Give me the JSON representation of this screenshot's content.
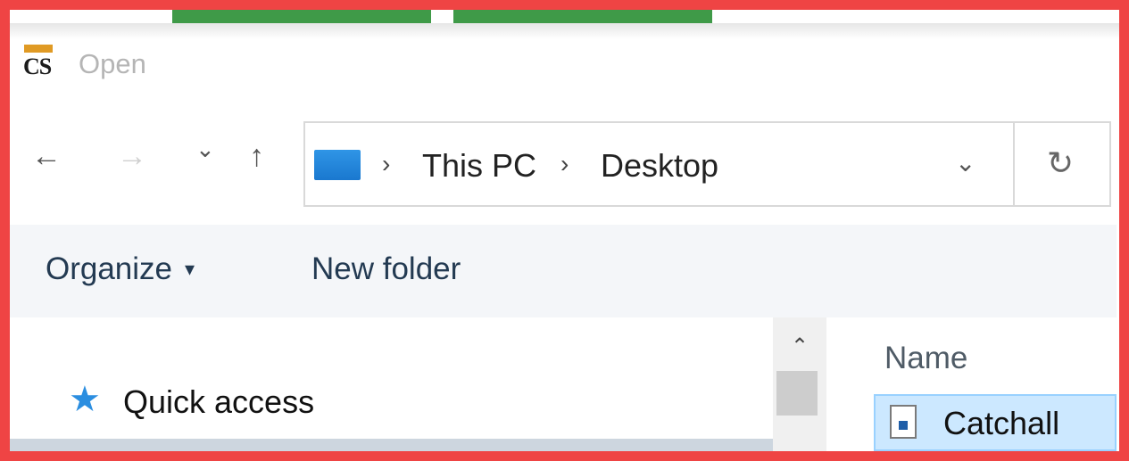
{
  "window": {
    "title": "Open",
    "app_icon": "cs-app-icon"
  },
  "nav": {
    "back_glyph": "←",
    "forward_glyph": "→",
    "recent_glyph": "⌄",
    "up_glyph": "↑"
  },
  "address_bar": {
    "breadcrumbs": [
      "This PC",
      "Desktop"
    ],
    "separator": "›",
    "dropdown_glyph": "⌄",
    "refresh_glyph": "↻"
  },
  "toolbar": {
    "organize_label": "Organize",
    "organize_caret": "▾",
    "new_folder_label": "New folder"
  },
  "navigation_pane": {
    "items": [
      {
        "label": "Quick access",
        "icon": "star-icon"
      }
    ],
    "scroll_up_glyph": "⌃"
  },
  "file_list": {
    "columns": [
      "Name"
    ],
    "rows": [
      {
        "name": "Catchall",
        "icon": "image-file-icon",
        "selected": true
      }
    ]
  },
  "colors": {
    "frame_border": "#ef4444",
    "selection_bg": "#cce8ff",
    "accent": "#2b8ee0"
  }
}
